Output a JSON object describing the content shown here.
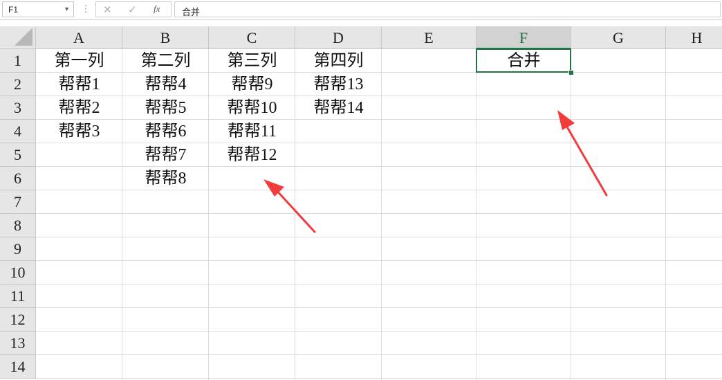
{
  "formula_bar": {
    "name_box": "F1",
    "cancel_icon": "✕",
    "enter_icon": "✓",
    "fx_icon": "fx",
    "formula": "合并"
  },
  "grid": {
    "columns": [
      "A",
      "B",
      "C",
      "D",
      "E",
      "F",
      "G",
      "H"
    ],
    "rows": [
      "1",
      "2",
      "3",
      "4",
      "5",
      "6",
      "7",
      "8",
      "9",
      "10",
      "11",
      "12",
      "13",
      "14"
    ],
    "selected_cell": "F1",
    "cells": {
      "A1": "第一列",
      "B1": "第二列",
      "C1": "第三列",
      "D1": "第四列",
      "F1": "合并",
      "A2": "帮帮1",
      "B2": "帮帮4",
      "C2": "帮帮9",
      "D2": "帮帮13",
      "A3": "帮帮2",
      "B3": "帮帮5",
      "C3": "帮帮10",
      "D3": "帮帮14",
      "A4": "帮帮3",
      "B4": "帮帮6",
      "C4": "帮帮11",
      "B5": "帮帮7",
      "C5": "帮帮12",
      "B6": "帮帮8"
    }
  },
  "colors": {
    "accent": "#217346",
    "annotation_arrow": "#f03c3c"
  },
  "icons": [
    "cancel-icon",
    "enter-icon",
    "fx-icon",
    "dropdown-arrow-icon"
  ]
}
